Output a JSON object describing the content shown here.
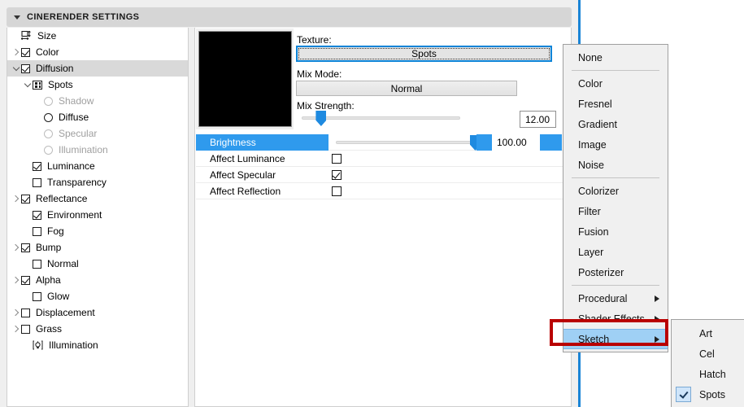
{
  "header": {
    "title": "CINERENDER SETTINGS",
    "collapse_icon": "triangle-down-icon"
  },
  "sidebar": {
    "items": [
      {
        "label": "Size",
        "indent": 1,
        "control": "icon-size",
        "arrow": "none",
        "checked": false,
        "dim": false,
        "selected": false
      },
      {
        "label": "Color",
        "indent": 1,
        "control": "checkbox",
        "arrow": "right",
        "checked": true,
        "dim": false,
        "selected": false
      },
      {
        "label": "Diffusion",
        "indent": 1,
        "control": "checkbox",
        "arrow": "down",
        "checked": true,
        "dim": false,
        "selected": true
      },
      {
        "label": "Spots",
        "indent": 2,
        "control": "icon-spots",
        "arrow": "down",
        "checked": false,
        "dim": false,
        "selected": false
      },
      {
        "label": "Shadow",
        "indent": 3,
        "control": "radio",
        "arrow": "none",
        "checked": false,
        "dim": true,
        "selected": false
      },
      {
        "label": "Diffuse",
        "indent": 3,
        "control": "radio",
        "arrow": "none",
        "checked": true,
        "dim": false,
        "selected": false
      },
      {
        "label": "Specular",
        "indent": 3,
        "control": "radio",
        "arrow": "none",
        "checked": false,
        "dim": true,
        "selected": false
      },
      {
        "label": "Illumination",
        "indent": 3,
        "control": "radio",
        "arrow": "none",
        "checked": false,
        "dim": true,
        "selected": false
      },
      {
        "label": "Luminance",
        "indent": 2,
        "control": "checkbox",
        "arrow": "none",
        "checked": true,
        "dim": false,
        "selected": false
      },
      {
        "label": "Transparency",
        "indent": 2,
        "control": "checkbox",
        "arrow": "none",
        "checked": false,
        "dim": false,
        "selected": false
      },
      {
        "label": "Reflectance",
        "indent": 1,
        "control": "checkbox",
        "arrow": "right",
        "checked": true,
        "dim": false,
        "selected": false
      },
      {
        "label": "Environment",
        "indent": 2,
        "control": "checkbox",
        "arrow": "none",
        "checked": true,
        "dim": false,
        "selected": false
      },
      {
        "label": "Fog",
        "indent": 2,
        "control": "checkbox",
        "arrow": "none",
        "checked": false,
        "dim": false,
        "selected": false
      },
      {
        "label": "Bump",
        "indent": 1,
        "control": "checkbox",
        "arrow": "right",
        "checked": true,
        "dim": false,
        "selected": false
      },
      {
        "label": "Normal",
        "indent": 2,
        "control": "checkbox",
        "arrow": "none",
        "checked": false,
        "dim": false,
        "selected": false
      },
      {
        "label": "Alpha",
        "indent": 1,
        "control": "checkbox",
        "arrow": "right",
        "checked": true,
        "dim": false,
        "selected": false
      },
      {
        "label": "Glow",
        "indent": 2,
        "control": "checkbox",
        "arrow": "none",
        "checked": false,
        "dim": false,
        "selected": false
      },
      {
        "label": "Displacement",
        "indent": 1,
        "control": "checkbox",
        "arrow": "right",
        "checked": false,
        "dim": false,
        "selected": false
      },
      {
        "label": "Grass",
        "indent": 1,
        "control": "checkbox",
        "arrow": "right",
        "checked": false,
        "dim": false,
        "selected": false
      },
      {
        "label": "Illumination",
        "indent": 2,
        "control": "icon-illum",
        "arrow": "none",
        "checked": false,
        "dim": false,
        "selected": false
      }
    ]
  },
  "main": {
    "preview_color": "#000000",
    "texture_label": "Texture:",
    "texture_value": "Spots",
    "mix_mode_label": "Mix Mode:",
    "mix_mode_value": "Normal",
    "mix_strength_label": "Mix Strength:",
    "mix_strength_value": "12.00",
    "mix_strength_percent": 12,
    "rows": [
      {
        "label": "Brightness",
        "type": "slider",
        "value": "100.00",
        "percent": 100,
        "highlighted": true
      },
      {
        "label": "Affect Luminance",
        "type": "checkbox",
        "checked": false
      },
      {
        "label": "Affect Specular",
        "type": "checkbox",
        "checked": true
      },
      {
        "label": "Affect Reflection",
        "type": "checkbox",
        "checked": false
      }
    ]
  },
  "menu": {
    "items": [
      {
        "label": "None",
        "type": "item",
        "active": false
      },
      {
        "label": "",
        "type": "separator"
      },
      {
        "label": "Color",
        "type": "item",
        "active": false
      },
      {
        "label": "Fresnel",
        "type": "item",
        "active": false
      },
      {
        "label": "Gradient",
        "type": "item",
        "active": false
      },
      {
        "label": "Image",
        "type": "item",
        "active": false
      },
      {
        "label": "Noise",
        "type": "item",
        "active": false
      },
      {
        "label": "",
        "type": "separator"
      },
      {
        "label": "Colorizer",
        "type": "item",
        "active": false
      },
      {
        "label": "Filter",
        "type": "item",
        "active": false
      },
      {
        "label": "Fusion",
        "type": "item",
        "active": false
      },
      {
        "label": "Layer",
        "type": "item",
        "active": false
      },
      {
        "label": "Posterizer",
        "type": "item",
        "active": false
      },
      {
        "label": "",
        "type": "separator"
      },
      {
        "label": "Procedural",
        "type": "submenu",
        "active": false
      },
      {
        "label": "Shader Effects",
        "type": "submenu",
        "active": false
      },
      {
        "label": "Sketch",
        "type": "submenu",
        "active": true
      }
    ]
  },
  "submenu": {
    "items": [
      {
        "label": "Art",
        "checked": false
      },
      {
        "label": "Cel",
        "checked": false
      },
      {
        "label": "Hatch",
        "checked": false
      },
      {
        "label": "Spots",
        "checked": true
      }
    ]
  },
  "colors": {
    "accent_blue": "#2f9aed",
    "menu_highlight": "#9fd0f5",
    "annotation_red": "#b90000",
    "rule_blue": "#1a84d6"
  }
}
